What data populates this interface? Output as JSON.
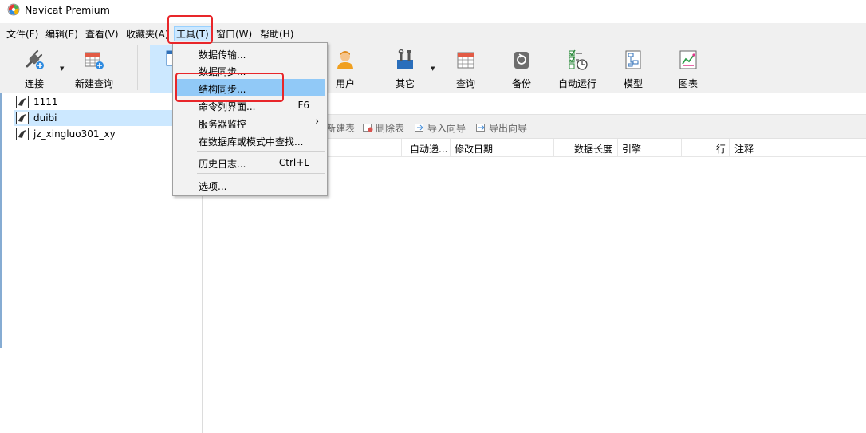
{
  "window": {
    "title": "Navicat Premium"
  },
  "menubar": {
    "items": [
      {
        "label": "文件(F)"
      },
      {
        "label": "编辑(E)"
      },
      {
        "label": "查看(V)"
      },
      {
        "label": "收藏夹(A)"
      },
      {
        "label": "工具(T)"
      },
      {
        "label": "窗口(W)"
      },
      {
        "label": "帮助(H)"
      }
    ],
    "active_index": 4
  },
  "toolbar": {
    "buttons": [
      {
        "label": "连接",
        "icon": "plug-icon"
      },
      {
        "label": "新建查询",
        "icon": "new-query-icon"
      },
      {
        "label": "用户",
        "icon": "user-icon"
      },
      {
        "label": "其它",
        "icon": "tools-icon"
      },
      {
        "label": "查询",
        "icon": "query-icon"
      },
      {
        "label": "备份",
        "icon": "backup-icon"
      },
      {
        "label": "自动运行",
        "icon": "schedule-icon"
      },
      {
        "label": "模型",
        "icon": "model-icon"
      },
      {
        "label": "图表",
        "icon": "chart-icon"
      }
    ]
  },
  "connections": [
    {
      "label": "1111",
      "selected": false
    },
    {
      "label": "duibi",
      "selected": true
    },
    {
      "label": "jz_xingluo301_xy",
      "selected": false
    }
  ],
  "object_toolbar": {
    "new_table": "新建表",
    "delete_table": "删除表",
    "import_wizard": "导入向导",
    "export_wizard": "导出向导"
  },
  "grid_columns": [
    "自动递...",
    "修改日期",
    "数据长度",
    "引擎",
    "行",
    "注释"
  ],
  "tools_menu": {
    "items": [
      {
        "label": "数据传输...",
        "shortcut": ""
      },
      {
        "label": "数据同步...",
        "shortcut": ""
      },
      {
        "label": "结构同步...",
        "shortcut": "",
        "hover": true
      },
      {
        "label": "命令列界面...",
        "shortcut": "F6"
      },
      {
        "label": "服务器监控",
        "shortcut": "",
        "submenu": true
      },
      {
        "label": "在数据库或模式中查找...",
        "shortcut": ""
      },
      {
        "label": "历史日志...",
        "shortcut": "Ctrl+L"
      },
      {
        "label": "选项...",
        "shortcut": ""
      }
    ],
    "submenu_arrow": "›"
  },
  "colors": {
    "highlight_box": "#e8262a",
    "menu_hover": "#91c9f7",
    "selection": "#cce8ff"
  }
}
